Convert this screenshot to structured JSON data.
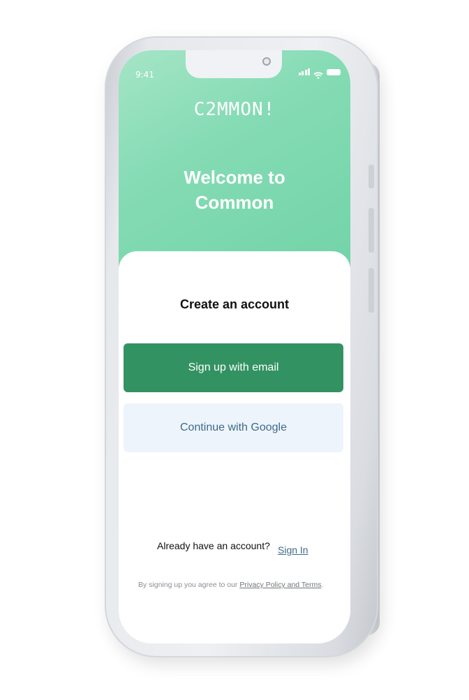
{
  "status_bar": {
    "time": "9:41"
  },
  "hero": {
    "logo": "C2MMON!",
    "welcome_line1": "Welcome to",
    "welcome_line2": "Common"
  },
  "signup": {
    "title": "Create an account",
    "email_button": "Sign up with email",
    "google_button": "Continue with Google"
  },
  "footer": {
    "already_text": "Already have an account?",
    "signin_link": "Sign In",
    "terms_prefix": "By signing up you agree to our ",
    "terms_link": "Privacy Policy and Terms",
    "terms_suffix": "."
  },
  "colors": {
    "brand_green": "#339262",
    "hero_green": "#84dbb4",
    "google_bg": "#eef4fb",
    "link_blue": "#3d6a8a"
  }
}
